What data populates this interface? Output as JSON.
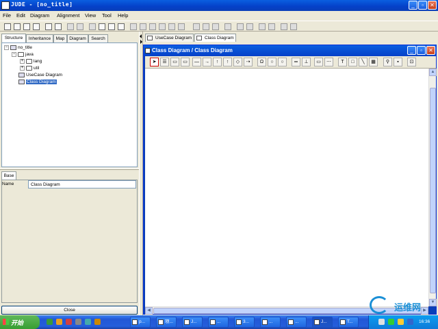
{
  "window": {
    "title": "JUDE - [no_title]"
  },
  "menu": [
    "File",
    "Edit",
    "Diagram",
    "Alignment",
    "View",
    "Tool",
    "Help"
  ],
  "left_tabs": [
    "Structure",
    "Inheritance",
    "Map",
    "Diagram",
    "Search"
  ],
  "tree": [
    {
      "label": "no_title",
      "icon": "project-icon"
    },
    {
      "label": "java",
      "icon": "folder-icon"
    },
    {
      "label": "lang",
      "icon": "folder-icon"
    },
    {
      "label": "util",
      "icon": "folder-icon"
    },
    {
      "label": "UseCase Diagram",
      "icon": "usecase-diagram-icon"
    },
    {
      "label": "Class Diagram",
      "icon": "class-diagram-icon",
      "selected": true
    }
  ],
  "properties": {
    "tab": "Base",
    "name_label": "Name",
    "name_value": "Class Diagram",
    "close_label": "Close"
  },
  "diagram_tabs": [
    "UseCase Diagram",
    "Class Diagram"
  ],
  "internal_frame": {
    "title": "Class Diagram / Class Diagram"
  },
  "palette_text": {
    "text_tool": "T"
  },
  "taskbar": {
    "start": "开始",
    "items": [
      "p...",
      "项...",
      "J...",
      "...",
      "3...",
      "...",
      "...",
      "J...",
      "T...",
      "..."
    ],
    "clock": "16:36"
  },
  "watermark": "运维网",
  "colors": {
    "titlebar": "#0a5fe0",
    "selection": "#316ac5",
    "taskbar": "#245edc",
    "start": "#379e32"
  }
}
